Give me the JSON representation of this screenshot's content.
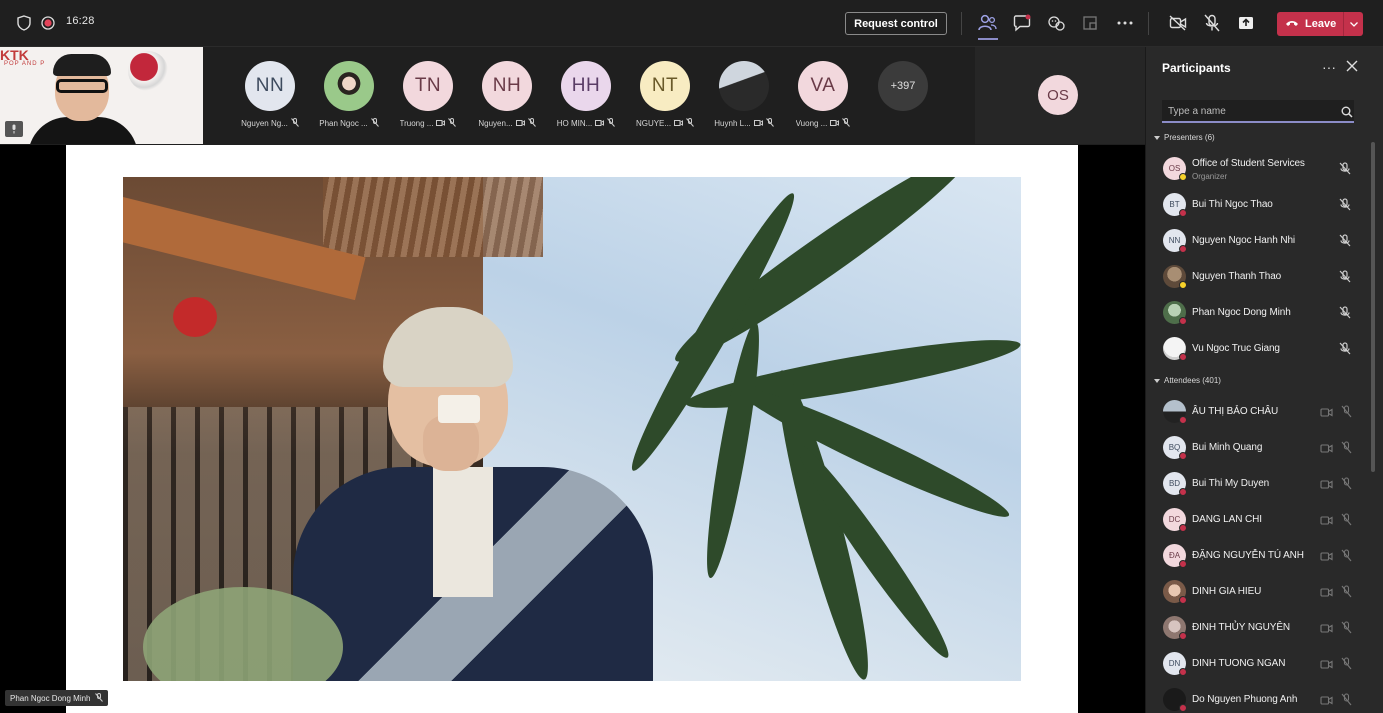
{
  "topbar": {
    "timer": "16:28",
    "request_control": "Request control",
    "leave": "Leave"
  },
  "gallery": {
    "participants": [
      {
        "initials": "NN",
        "name": "Nguyen Ng..."
      },
      {
        "initials": "",
        "name": "Phan Ngoc ..."
      },
      {
        "initials": "TN",
        "name": "Truong ..."
      },
      {
        "initials": "NH",
        "name": "Nguyen..."
      },
      {
        "initials": "HH",
        "name": "HO MIN..."
      },
      {
        "initials": "NT",
        "name": "NGUYE..."
      },
      {
        "initials": "",
        "name": "Huynh L..."
      },
      {
        "initials": "VA",
        "name": "Vuong ..."
      }
    ],
    "more_count": "+397",
    "organizer_initials": "OS"
  },
  "stage": {
    "speaker_label": "Phan Ngoc Dong Minh"
  },
  "panel": {
    "title": "Participants",
    "search_placeholder": "Type a name",
    "presenters_header": "Presenters (6)",
    "attendees_header": "Attendees (401)",
    "presenters": [
      {
        "initials": "OS",
        "name": "Office of Student Services",
        "sub": "Organizer"
      },
      {
        "initials": "BT",
        "name": "Bui Thi Ngoc Thao",
        "sub": ""
      },
      {
        "initials": "NN",
        "name": "Nguyen Ngoc Hanh Nhi",
        "sub": ""
      },
      {
        "initials": "",
        "name": "Nguyen Thanh Thao",
        "sub": ""
      },
      {
        "initials": "",
        "name": "Phan Ngoc Dong Minh",
        "sub": ""
      },
      {
        "initials": "",
        "name": "Vu Ngoc Truc Giang",
        "sub": ""
      }
    ],
    "attendees": [
      {
        "initials": "",
        "name": "ÂU THỊ BẢO CHÂU"
      },
      {
        "initials": "BQ",
        "name": "Bui Minh Quang"
      },
      {
        "initials": "BD",
        "name": "Bui Thi My Duyen"
      },
      {
        "initials": "DC",
        "name": "DANG LAN CHI"
      },
      {
        "initials": "ĐA",
        "name": "ĐẶNG NGUYỄN TÚ ANH"
      },
      {
        "initials": "",
        "name": "DINH GIA HIEU"
      },
      {
        "initials": "",
        "name": "ĐINH THỦY NGUYÊN"
      },
      {
        "initials": "DN",
        "name": "DINH TUONG NGAN"
      },
      {
        "initials": "",
        "name": "Do Nguyen Phuong Anh"
      }
    ]
  },
  "self_view": {
    "brand_text": "KTK",
    "brand_sub": "POP AND P"
  }
}
